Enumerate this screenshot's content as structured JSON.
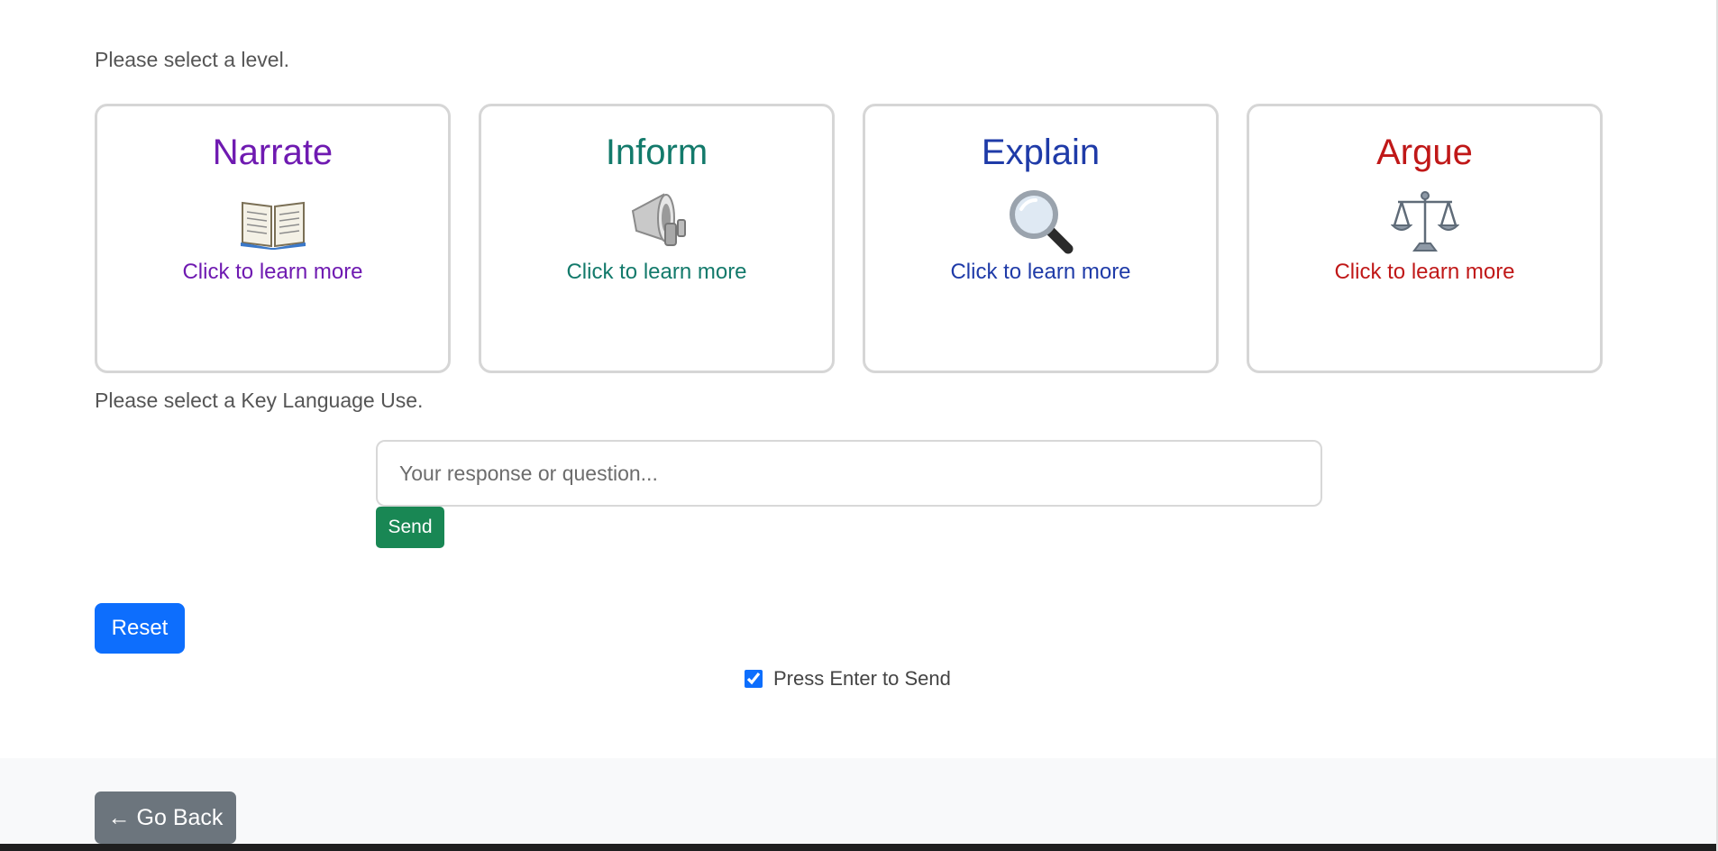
{
  "prompts": {
    "level": "Please select a level.",
    "key_language_use": "Please select a Key Language Use."
  },
  "cards": [
    {
      "title": "Narrate",
      "link": "Click to learn more",
      "color": "#6f1ab1",
      "icon": "open-book-icon"
    },
    {
      "title": "Inform",
      "link": "Click to learn more",
      "color": "#137a6b",
      "icon": "megaphone-icon"
    },
    {
      "title": "Explain",
      "link": "Click to learn more",
      "color": "#1f3ba8",
      "icon": "magnifying-glass-icon"
    },
    {
      "title": "Argue",
      "link": "Click to learn more",
      "color": "#c01818",
      "icon": "balance-scale-icon"
    }
  ],
  "chat": {
    "placeholder": "Your response or question...",
    "send_label": "Send"
  },
  "reset_label": "Reset",
  "enter_to_send": {
    "label": "Press Enter to Send",
    "checked": true
  },
  "footer": {
    "back_label": "← Go Back"
  }
}
